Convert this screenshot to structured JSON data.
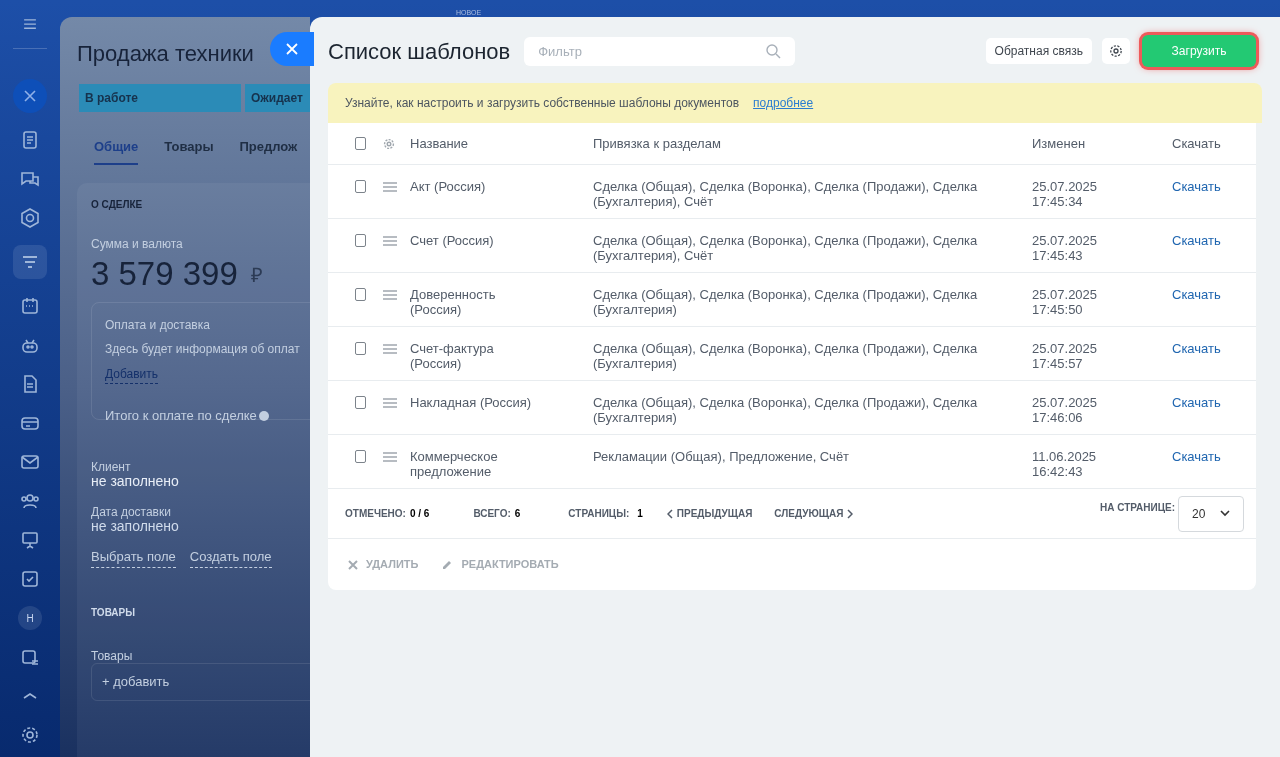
{
  "background": {
    "badge": "НОВОЕ",
    "deal": {
      "title": "Продажа техники",
      "stages": [
        {
          "label": "В работе"
        },
        {
          "label": "Ожидает"
        }
      ],
      "tabs": [
        {
          "label": "Общие",
          "selected": true
        },
        {
          "label": "Товары",
          "selected": false
        },
        {
          "label": "Предлож",
          "selected": false
        }
      ],
      "section": "О СДЕЛКЕ",
      "amount_label": "Сумма и валюта",
      "amount": "3 579 399",
      "currency": "₽",
      "payment": {
        "title": "Оплата и доставка",
        "text": "Здесь будет информация об оплат",
        "link": "Добавить",
        "total": "Итого к оплате по сделке"
      },
      "fields": [
        {
          "label": "Клиент",
          "value": "не заполнено"
        },
        {
          "label": "Дата доставки",
          "value": "не заполнено"
        }
      ],
      "field_links": [
        "Выбрать поле",
        "Создать поле"
      ],
      "products_section": "ТОВАРЫ",
      "products_label": "Товары",
      "products_add": "+ добавить"
    },
    "sidebar_badge": "H"
  },
  "modal": {
    "title": "Список шаблонов",
    "filter": {
      "placeholder": "Фильтр"
    },
    "feedback": "Обратная связь",
    "upload": "Загрузить",
    "banner": {
      "text": "Узнайте, как настроить и загрузить собственные шаблоны документов",
      "link": "подробнее"
    },
    "table": {
      "all_checked": false,
      "columns": [
        "Название",
        "Привязка к разделам",
        "Изменен",
        "Скачать"
      ],
      "rows": [
        {
          "checked": false,
          "name": "Акт (Россия)",
          "sections": "Сделка (Общая), Сделка (Воронка), Сделка (Продажи), Сделка (Бухгалтерия), Счёт",
          "date": "25.07.2025",
          "time": "17:45:34",
          "download": "Скачать"
        },
        {
          "checked": false,
          "name": "Счет (Россия)",
          "sections": "Сделка (Общая), Сделка (Воронка), Сделка (Продажи), Сделка (Бухгалтерия), Счёт",
          "date": "25.07.2025",
          "time": "17:45:43",
          "download": "Скачать"
        },
        {
          "checked": false,
          "name": "Доверенность (Россия)",
          "sections": "Сделка (Общая), Сделка (Воронка), Сделка (Продажи), Сделка (Бухгалтерия)",
          "date": "25.07.2025",
          "time": "17:45:50",
          "download": "Скачать"
        },
        {
          "checked": false,
          "name": "Счет-фактура (Россия)",
          "sections": "Сделка (Общая), Сделка (Воронка), Сделка (Продажи), Сделка (Бухгалтерия)",
          "date": "25.07.2025",
          "time": "17:45:57",
          "download": "Скачать"
        },
        {
          "checked": false,
          "name": "Накладная (Россия)",
          "sections": "Сделка (Общая), Сделка (Воронка), Сделка (Продажи), Сделка (Бухгалтерия)",
          "date": "25.07.2025",
          "time": "17:46:06",
          "download": "Скачать"
        },
        {
          "checked": false,
          "name": "Коммерческое предложение",
          "sections": "Рекламации (Общая), Предложение, Счёт",
          "date": "11.06.2025",
          "time": "16:42:43",
          "download": "Скачать"
        }
      ]
    },
    "footer": {
      "marked_label": "ОТМЕЧЕНО:",
      "marked": "0 / 6",
      "total_label": "ВСЕГО:",
      "total": "6",
      "pages_label": "СТРАНИЦЫ:",
      "pages": "1",
      "prev": "ПРЕДЫДУЩАЯ",
      "next": "СЛЕДУЮЩАЯ",
      "per_page_label": "НА СТРАНИЦЕ:",
      "per_page": "20"
    },
    "actions": [
      {
        "label": "УДАЛИТЬ",
        "kind": "delete",
        "disabled": true
      },
      {
        "label": "РЕДАКТИРОВАТЬ",
        "kind": "edit",
        "disabled": true
      }
    ]
  }
}
